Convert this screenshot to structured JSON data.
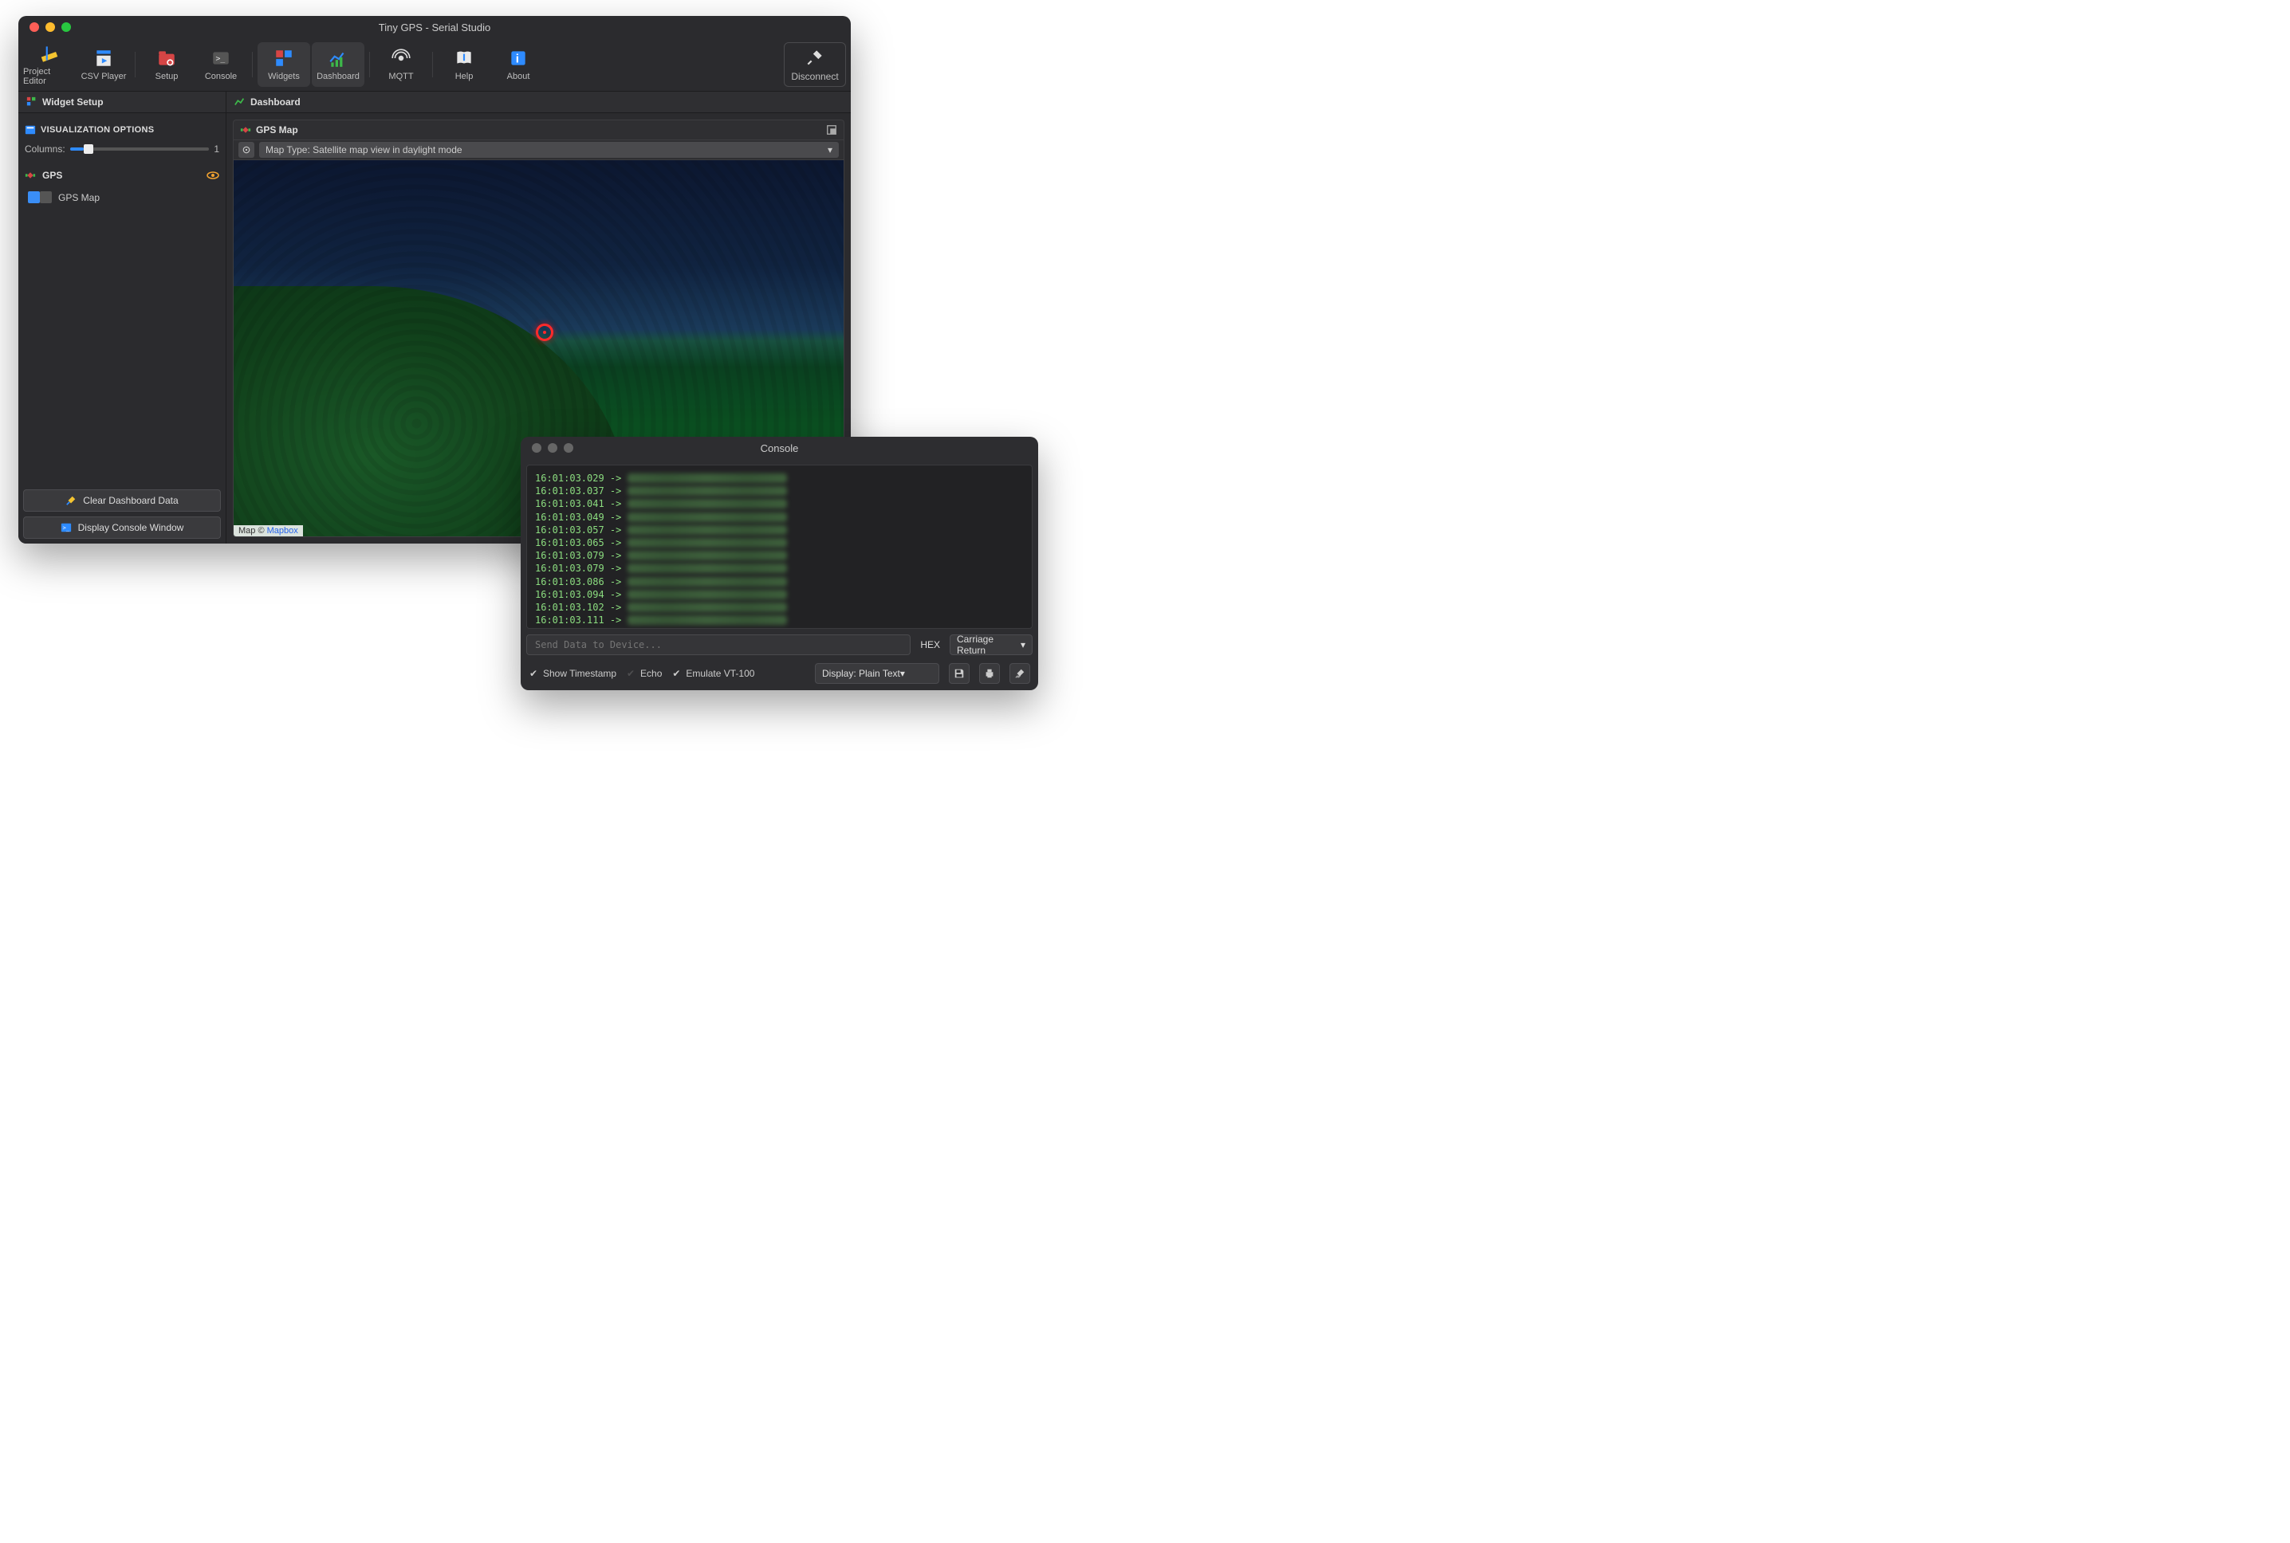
{
  "main_window": {
    "title": "Tiny GPS - Serial Studio",
    "toolbar": {
      "project_editor": "Project Editor",
      "csv_player": "CSV Player",
      "setup": "Setup",
      "console": "Console",
      "widgets": "Widgets",
      "dashboard": "Dashboard",
      "mqtt": "MQTT",
      "help": "Help",
      "about": "About",
      "disconnect": "Disconnect"
    },
    "tabs": {
      "widget_setup": "Widget Setup",
      "dashboard": "Dashboard"
    },
    "sidebar": {
      "visualization_options": "VISUALIZATION OPTIONS",
      "columns_label": "Columns:",
      "columns_value": "1",
      "group": {
        "name": "GPS"
      },
      "items": [
        {
          "label": "GPS Map",
          "checked": true
        }
      ],
      "buttons": {
        "clear_dashboard": "Clear Dashboard Data",
        "display_console": "Display Console Window"
      }
    },
    "panel": {
      "title": "GPS Map",
      "map_type": "Map Type: Satellite map view in daylight mode",
      "attrib_prefix": "Map © ",
      "attrib_link": "Mapbox"
    }
  },
  "console_window": {
    "title": "Console",
    "lines": [
      "16:01:03.029 ->",
      "16:01:03.037 ->",
      "16:01:03.041 ->",
      "16:01:03.049 ->",
      "16:01:03.057 ->",
      "16:01:03.065 ->",
      "16:01:03.079 ->",
      "16:01:03.079 ->",
      "16:01:03.086 ->",
      "16:01:03.094 ->",
      "16:01:03.102 ->",
      "16:01:03.111 ->"
    ],
    "send_placeholder": "Send Data to Device...",
    "hex_label": "HEX",
    "line_ending": "Carriage Return",
    "show_timestamp": "Show Timestamp",
    "echo": "Echo",
    "emulate_vt100": "Emulate VT-100",
    "display_mode": "Display: Plain Text"
  },
  "colors": {
    "accent": "#3a8ef6",
    "term_green": "#8bdc7f"
  }
}
